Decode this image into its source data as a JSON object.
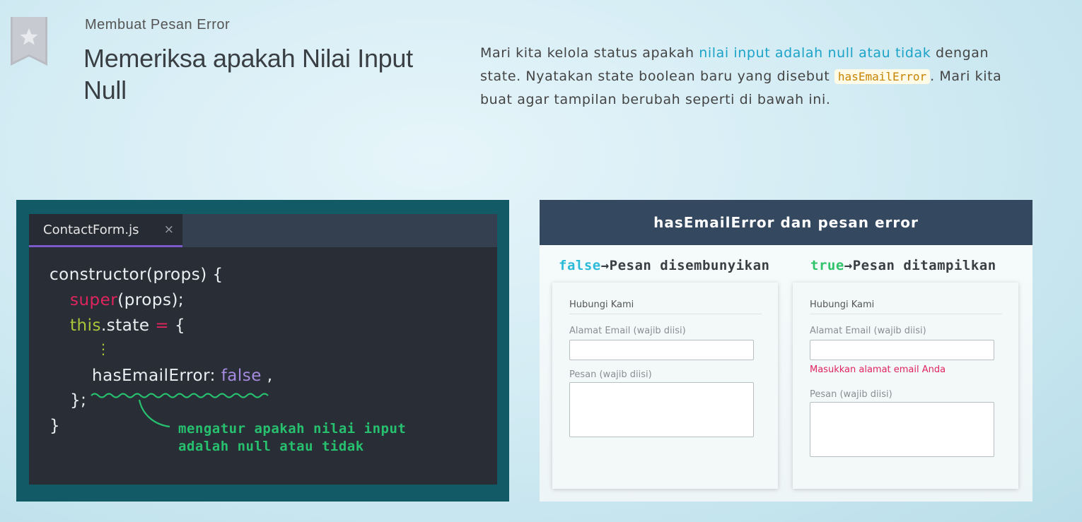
{
  "page": {
    "subtitle": "Membuat Pesan Error",
    "title": "Memeriksa apakah Nilai Input Null"
  },
  "description": {
    "part1": "Mari kita kelola status apakah ",
    "link_text": "nilai input adalah null atau tidak",
    "part2": " dengan state. Nyatakan state boolean baru yang disebut ",
    "code": "hasEmailError",
    "part3": ". Mari kita buat agar tampilan berubah seperti di bawah ini."
  },
  "editor": {
    "tab_name": "ContactForm.js",
    "tab_close": "×",
    "lines": {
      "l1": "constructor(props) {",
      "l2_kw": "super",
      "l2_rest": "(props);",
      "l3_kw": "this",
      "l3_mid": ".state ",
      "l3_op": "=",
      "l3_end": " {",
      "l4": "⋮",
      "l5_key": "hasEmailError: ",
      "l5_val": "false",
      "l5_end": " ,",
      "l6": "};",
      "l7": "}"
    },
    "annotation_line1": "mengatur apakah nilai input",
    "annotation_line2": "adalah null atau tidak"
  },
  "diagram": {
    "header": "hasEmailError dan pesan error",
    "left_case": {
      "flag": "false",
      "arrow": "→",
      "text": "Pesan disembunyikan"
    },
    "right_case": {
      "flag": "true",
      "arrow": "→",
      "text": "Pesan ditampilkan"
    },
    "form": {
      "title": "Hubungi Kami",
      "email_label": "Alamat Email (wajib diisi)",
      "message_label": "Pesan (wajib diisi)",
      "error_message": "Masukkan alamat email Anda"
    }
  },
  "colors": {
    "link": "#1ba3c8",
    "code_panel_bg": "#115a66",
    "diagram_header_bg": "#34495f",
    "error": "#e0245e",
    "annotation": "#27c06e"
  }
}
